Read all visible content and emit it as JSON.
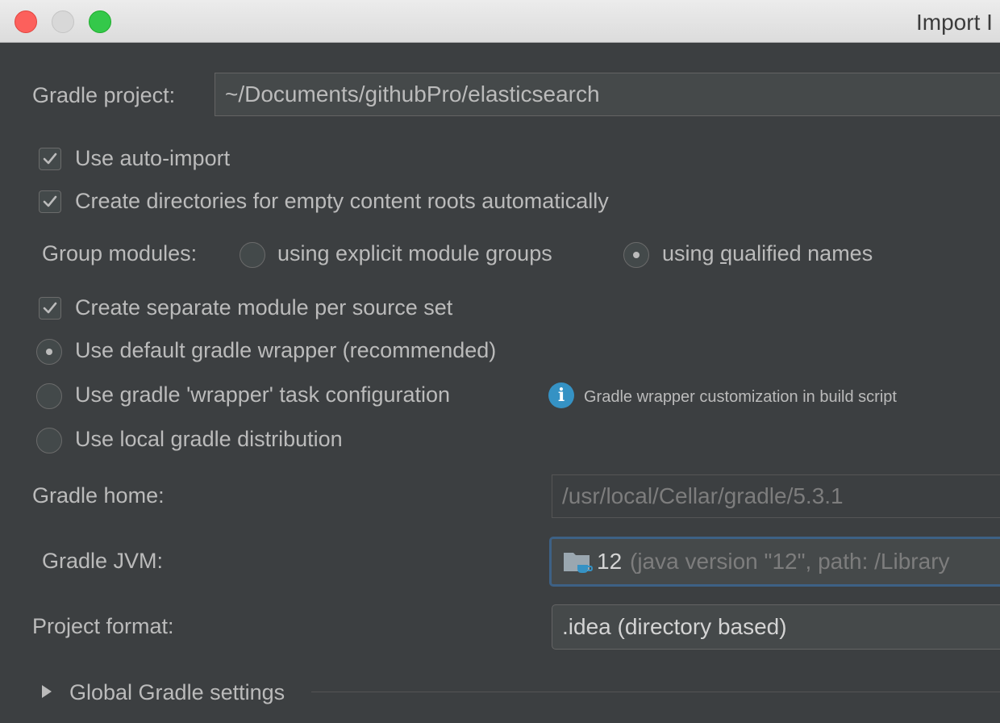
{
  "window": {
    "title": "Import I"
  },
  "form": {
    "gradle_project_label": "Gradle project:",
    "gradle_project_value": "~/Documents/githubPro/elasticsearch",
    "use_auto_import": {
      "label": "Use auto-import",
      "checked": true
    },
    "create_dirs": {
      "label": "Create directories for empty content roots automatically",
      "checked": true
    },
    "group_modules_label": "Group modules:",
    "group_option_explicit": {
      "pre": "using explicit module ",
      "mnemonic": "g",
      "post": "roups",
      "selected": false
    },
    "group_option_qualified": {
      "pre": "using ",
      "mnemonic": "q",
      "post": "ualified names",
      "selected": true
    },
    "separate_module": {
      "label": "Create separate module per source set",
      "checked": true
    },
    "wrapper_default": {
      "label": "Use default gradle wrapper (recommended)",
      "selected": true
    },
    "wrapper_task": {
      "label": "Use gradle 'wrapper' task configuration",
      "selected": false
    },
    "wrapper_info_text": "Gradle wrapper customization in build script",
    "local_distribution": {
      "label": "Use local gradle distribution",
      "selected": false
    },
    "gradle_home_label": "Gradle home:",
    "gradle_home_value": "/usr/local/Cellar/gradle/5.3.1",
    "gradle_jvm_label": "Gradle JVM:",
    "gradle_jvm_name": "12",
    "gradle_jvm_detail": "(java version \"12\", path: /Library",
    "project_format_label": "Project format:",
    "project_format_value": ".idea (directory based)",
    "global_settings_label": "Global Gradle settings"
  },
  "icons": {
    "checkbox_checked": "check-mark",
    "info": "info-icon",
    "jdk": "folder-cup-icon",
    "expand": "triangle-right-icon"
  },
  "colors": {
    "background": "#3c3f41",
    "text": "#bbbbbb",
    "focus": "#3d6185",
    "info": "#3592c4",
    "close": "#fc605c",
    "maximize": "#34c84a"
  }
}
